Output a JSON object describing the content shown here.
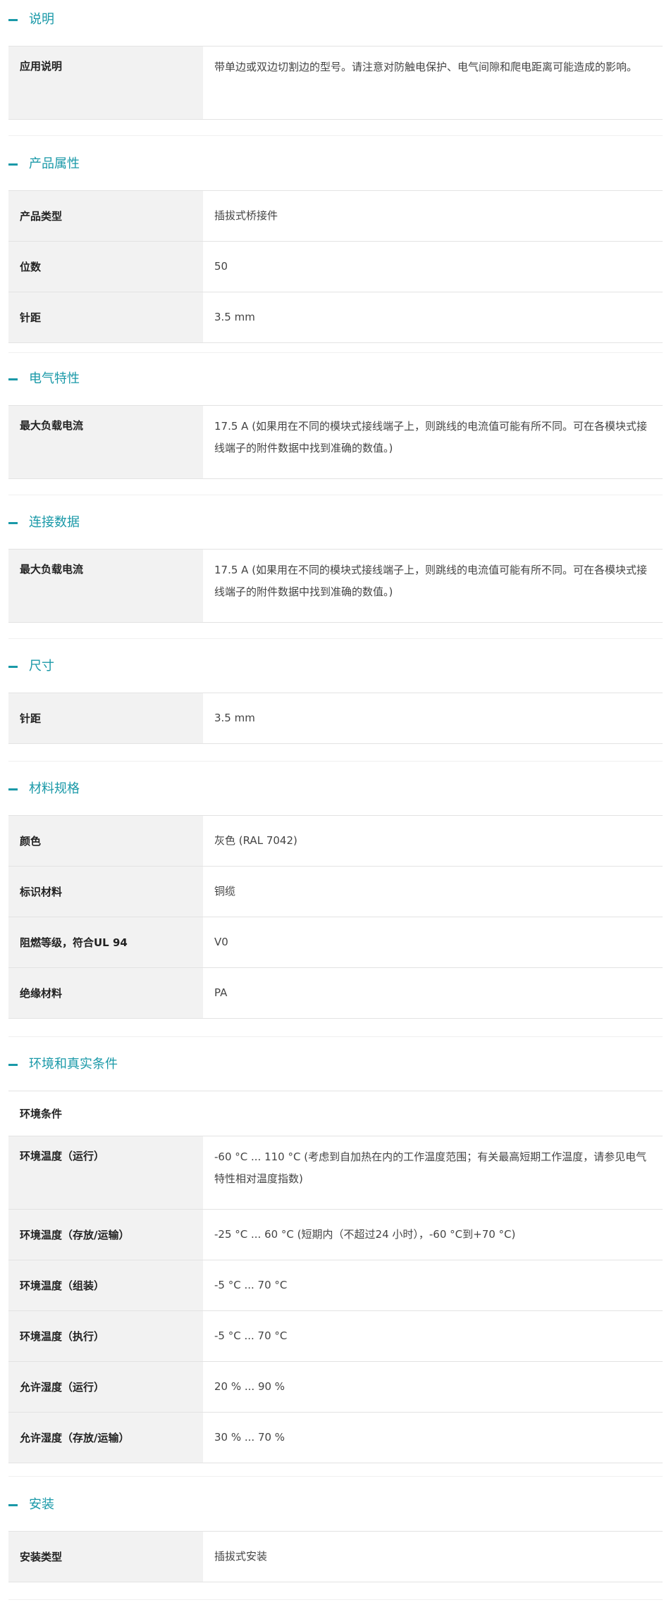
{
  "accent_color": "#1a99a8",
  "sections": [
    {
      "title": "说明",
      "rows": [
        {
          "label": "应用说明",
          "value": "带单边或双边切割边的型号。请注意对防触电保护、电气间隙和爬电距离可能造成的影响。"
        }
      ]
    },
    {
      "title": "产品属性",
      "rows": [
        {
          "label": "产品类型",
          "value": "插拔式桥接件"
        },
        {
          "label": "位数",
          "value": "50"
        },
        {
          "label": "针距",
          "value": "3.5 mm"
        }
      ]
    },
    {
      "title": "电气特性",
      "rows": [
        {
          "label": "最大负载电流",
          "value": "17.5 A (如果用在不同的模块式接线端子上，则跳线的电流值可能有所不同。可在各模块式接线端子的附件数据中找到准确的数值。)"
        }
      ]
    },
    {
      "title": "连接数据",
      "rows": [
        {
          "label": "最大负载电流",
          "value": "17.5 A (如果用在不同的模块式接线端子上，则跳线的电流值可能有所不同。可在各模块式接线端子的附件数据中找到准确的数值。)"
        }
      ]
    },
    {
      "title": "尺寸",
      "rows": [
        {
          "label": "针距",
          "value": "3.5 mm"
        }
      ]
    },
    {
      "title": "材料规格",
      "rows": [
        {
          "label": "颜色",
          "value": "灰色 (RAL 7042)"
        },
        {
          "label": "标识材料",
          "value": "铜缆"
        },
        {
          "label": "阻燃等级，符合UL 94",
          "value": "V0"
        },
        {
          "label": "绝缘材料",
          "value": "PA"
        }
      ]
    },
    {
      "title": "环境和真实条件",
      "subheader": "环境条件",
      "rows": [
        {
          "label": "环境温度（运行）",
          "value": "-60 °C ... 110 °C (考虑到自加热在内的工作温度范围；有关最高短期工作温度，请参见电气特性相对温度指数)"
        },
        {
          "label": "环境温度（存放/运输）",
          "value": "-25 °C ... 60 °C (短期内（不超过24 小时），-60 °C到+70 °C)"
        },
        {
          "label": "环境温度（组装）",
          "value": "-5 °C ... 70 °C"
        },
        {
          "label": "环境温度（执行）",
          "value": "-5 °C ... 70 °C"
        },
        {
          "label": "允许湿度（运行）",
          "value": "20 % ... 90 %"
        },
        {
          "label": "允许湿度（存放/运输）",
          "value": "30 % ... 70 %"
        }
      ]
    },
    {
      "title": "安装",
      "rows": [
        {
          "label": "安装类型",
          "value": "插拔式安装"
        }
      ]
    }
  ]
}
